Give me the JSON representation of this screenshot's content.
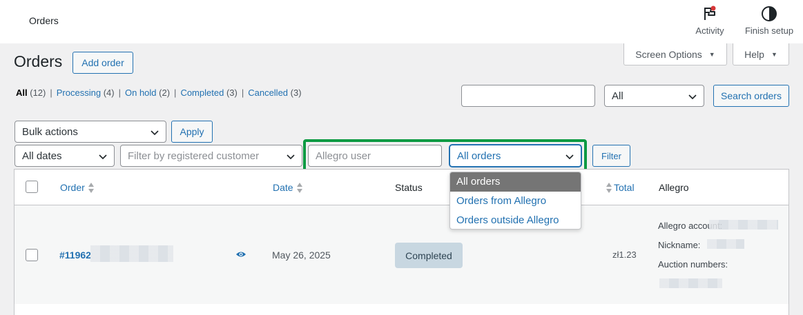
{
  "topbar": {
    "title": "Orders",
    "activity_label": "Activity",
    "finish_setup_label": "Finish setup"
  },
  "screen_options": {
    "label": "Screen Options",
    "help_label": "Help"
  },
  "page": {
    "title": "Orders",
    "add_order_label": "Add order"
  },
  "status_filters": [
    {
      "label": "All",
      "count": "(12)"
    },
    {
      "label": "Processing",
      "count": "(4)"
    },
    {
      "label": "On hold",
      "count": "(2)"
    },
    {
      "label": "Completed",
      "count": "(3)"
    },
    {
      "label": "Cancelled",
      "count": "(3)"
    }
  ],
  "search": {
    "value": "",
    "type_select": "All",
    "button_label": "Search orders"
  },
  "bulk": {
    "select": "Bulk actions",
    "apply_label": "Apply"
  },
  "filters": {
    "dates": "All dates",
    "customer_placeholder": "Filter by registered customer",
    "allegro_user_placeholder": "Allegro user",
    "allegro_orders": "All orders",
    "filter_label": "Filter"
  },
  "dropdown": {
    "options": [
      "All orders",
      "Orders from Allegro",
      "Orders outside Allegro"
    ],
    "selected_index": 0
  },
  "table": {
    "columns": {
      "order": "Order",
      "date": "Date",
      "status": "Status",
      "total": "Total",
      "allegro": "Allegro"
    },
    "rows": [
      {
        "order_number": "#11962",
        "date": "May 26, 2025",
        "status": "Completed",
        "total": "zł1.23",
        "allegro_account_label": "Allegro account:",
        "nickname_label": "Nickname:",
        "auction_numbers_label": "Auction numbers:"
      }
    ]
  },
  "colors": {
    "accent": "#2271b1",
    "highlight": "#0c9a43",
    "badge_bg": "#c8d7e1"
  }
}
